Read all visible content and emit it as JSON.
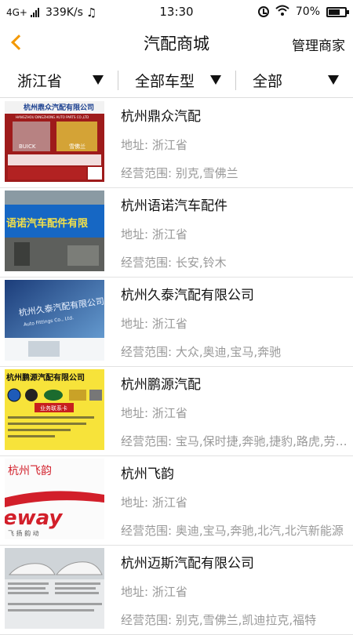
{
  "status": {
    "network": "4G+",
    "speed": "339K/s",
    "music_icon": "♫",
    "time": "13:30",
    "battery": "70%",
    "battery_level": 0.7
  },
  "nav": {
    "title": "汽配商城",
    "manage": "管理商家"
  },
  "filters": [
    {
      "label": "浙江省"
    },
    {
      "label": "全部车型"
    },
    {
      "label": "全部"
    }
  ],
  "items": [
    {
      "name": "杭州鼎众汽配",
      "address": "地址: 浙江省",
      "scope": "经营范围: 别克,雪佛兰",
      "thumb_text": "杭州鼎众汽配有限公司",
      "thumb_sub": "HANGZHOU DINGZHONG AUTO PARTS CO.,LTD",
      "thumb_brands": [
        "BUICK",
        "雪佛兰"
      ]
    },
    {
      "name": "杭州语诺汽车配件",
      "address": "地址: 浙江省",
      "scope": "经营范围: 长安,铃木",
      "thumb_text": "语诺汽车配件有限"
    },
    {
      "name": "杭州久泰汽配有限公司",
      "address": "地址: 浙江省",
      "scope": "经营范围: 大众,奥迪,宝马,奔驰",
      "thumb_text": "杭州久泰汽配有限公司",
      "thumb_sub": "Auto Fittings Co., Ltd."
    },
    {
      "name": "杭州鹏源汽配",
      "address": "地址: 浙江省",
      "scope": "经营范围: 宝马,保时捷,奔驰,捷豹,路虎,劳斯莱斯",
      "thumb_text": "杭州鹏源汽配有限公司",
      "thumb_sub": "业务联系卡"
    },
    {
      "name": "杭州飞韵",
      "address": "地址: 浙江省",
      "scope": "经营范围: 奥迪,宝马,奔驰,北汽,北汽新能源",
      "thumb_text": "杭州飞韵",
      "thumb_sub": "eway",
      "thumb_small": "飞 扬 韵 动"
    },
    {
      "name": "杭州迈斯汽配有限公司",
      "address": "地址: 浙江省",
      "scope": "经营范围: 别克,雪佛兰,凯迪拉克,福特"
    }
  ]
}
